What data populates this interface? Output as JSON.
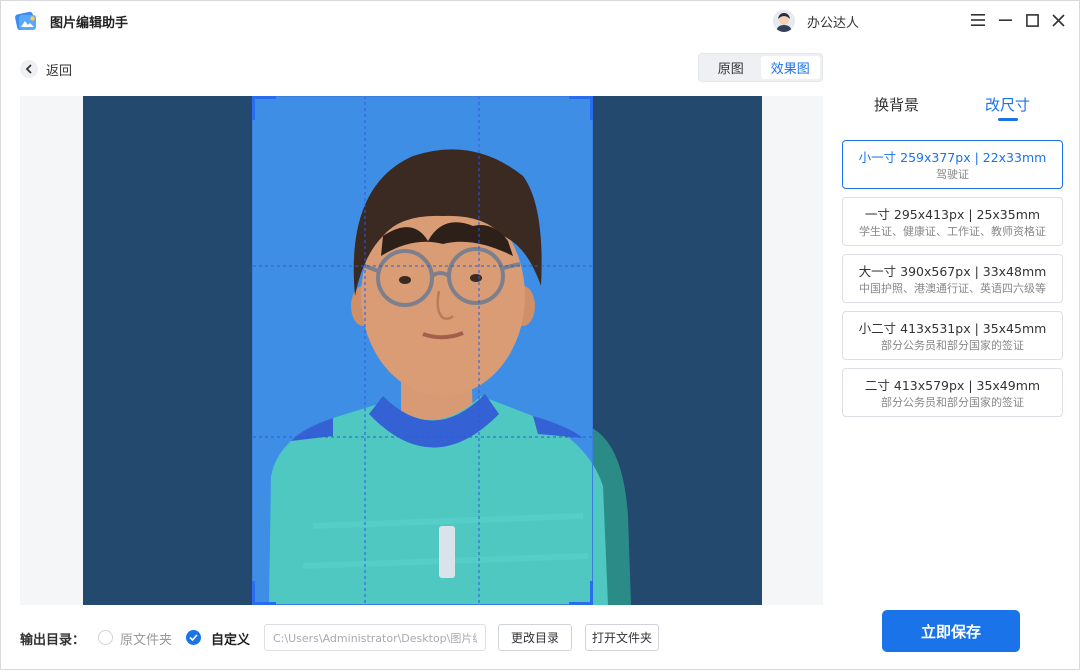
{
  "app": {
    "title": "图片编辑助手",
    "user_name": "办公达人"
  },
  "nav": {
    "back_label": "返回"
  },
  "view_toggle": {
    "options": [
      "原图",
      "效果图"
    ],
    "active": "效果图"
  },
  "tabs": [
    {
      "label": "换背景",
      "active": false
    },
    {
      "label": "改尺寸",
      "active": true
    }
  ],
  "sizes": [
    {
      "title": "小一寸 259x377px | 22x33mm",
      "desc": "驾驶证",
      "selected": true
    },
    {
      "title": "一寸 295x413px | 25x35mm",
      "desc": "学生证、健康证、工作证、教师资格证",
      "selected": false
    },
    {
      "title": "大一寸 390x567px | 33x48mm",
      "desc": "中国护照、港澳通行证、英语四六级等",
      "selected": false
    },
    {
      "title": "小二寸 413x531px | 35x45mm",
      "desc": "部分公务员和部分国家的签证",
      "selected": false
    },
    {
      "title": "二寸 413x579px | 35x49mm",
      "desc": "部分公务员和部分国家的签证",
      "selected": false
    }
  ],
  "output": {
    "label": "输出目录：",
    "option_original": "原文件夹",
    "option_custom": "自定义",
    "selected": "自定义",
    "path_value": "C:\\Users\\Administrator\\Desktop\\图片编辑",
    "change_dir_label": "更改目录",
    "open_folder_label": "打开文件夹"
  },
  "save_label": "立即保存",
  "colors": {
    "accent": "#1a73e8",
    "photo_background": "#23496f",
    "crop_background": "#3f8ee6"
  },
  "icons": {
    "app": "app-logo-icon",
    "back": "chevron-left-icon",
    "menu": "menu-icon",
    "minimize": "minimize-icon",
    "maximize": "maximize-icon",
    "close": "close-icon",
    "radio_checked": "check-icon"
  }
}
